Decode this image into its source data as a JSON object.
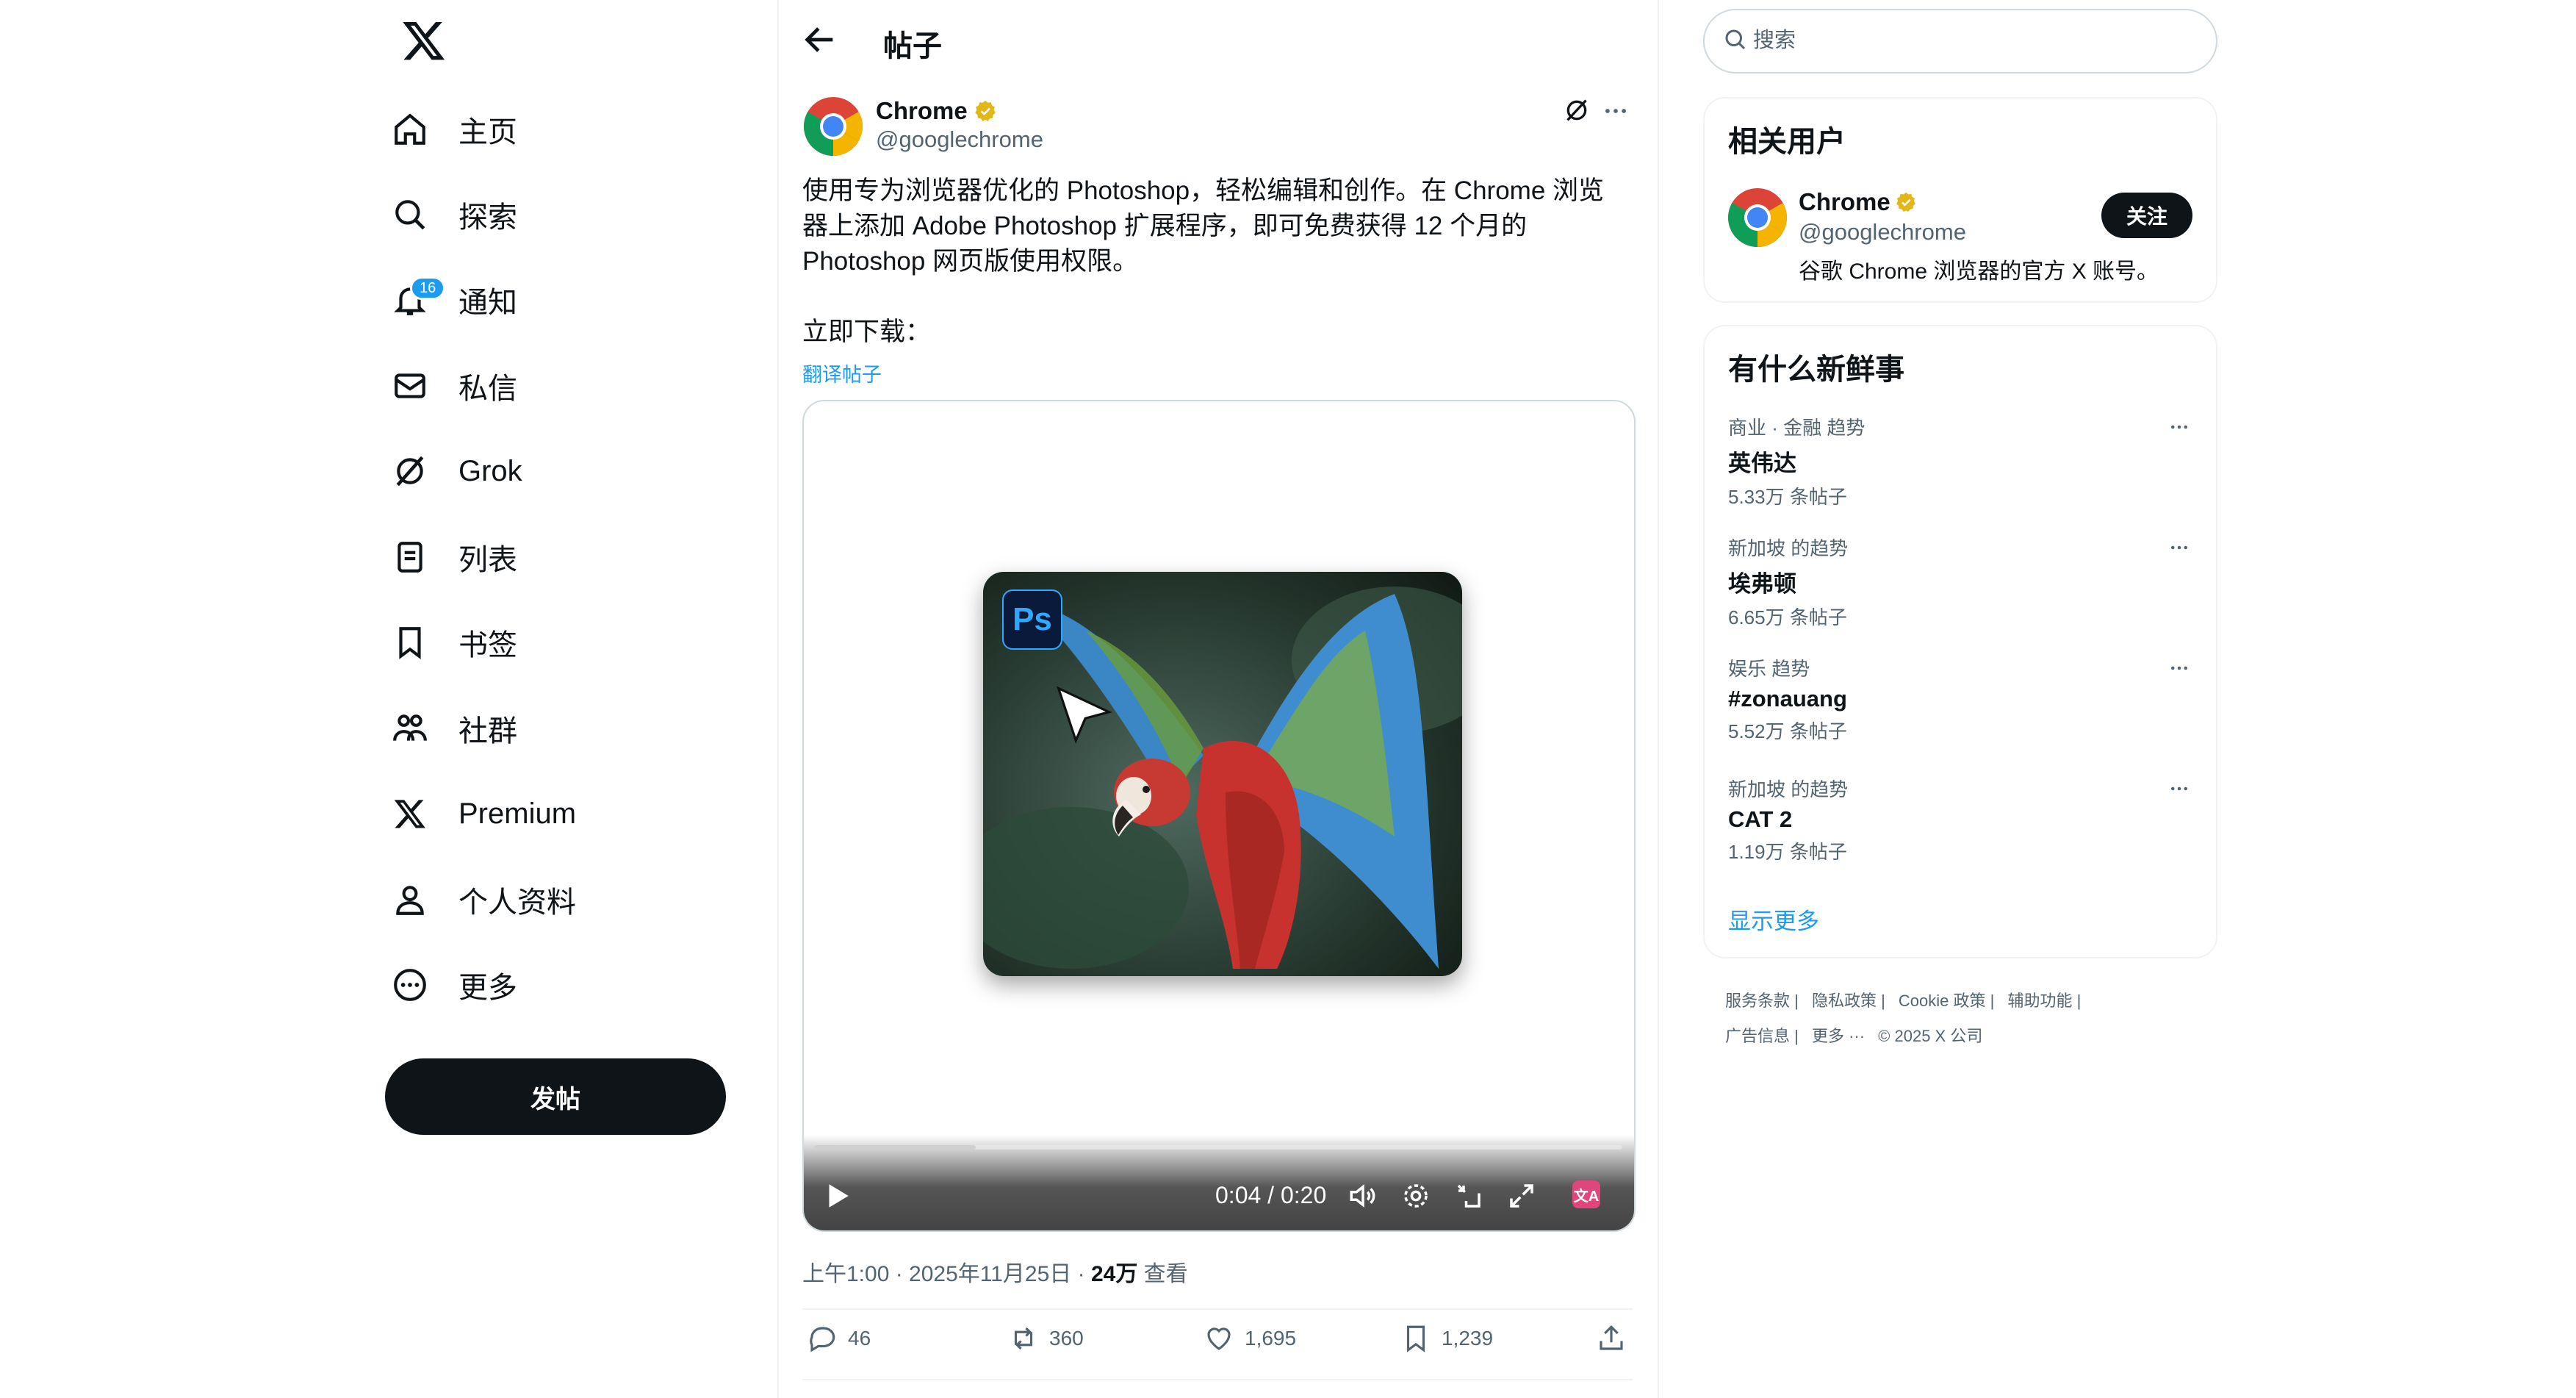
{
  "nav": {
    "items": [
      {
        "label": "主页",
        "icon": "home-icon"
      },
      {
        "label": "探索",
        "icon": "search-icon"
      },
      {
        "label": "通知",
        "icon": "bell-icon",
        "badge": "16"
      },
      {
        "label": "私信",
        "icon": "mail-icon"
      },
      {
        "label": "Grok",
        "icon": "grok-icon"
      },
      {
        "label": "列表",
        "icon": "list-icon"
      },
      {
        "label": "书签",
        "icon": "bookmark-icon"
      },
      {
        "label": "社群",
        "icon": "people-icon"
      },
      {
        "label": "Premium",
        "icon": "x-premium-icon"
      },
      {
        "label": "个人资料",
        "icon": "profile-icon"
      },
      {
        "label": "更多",
        "icon": "more-circle-icon"
      }
    ],
    "post_button": "发帖"
  },
  "header": {
    "title": "帖子"
  },
  "post": {
    "author_name": "Chrome",
    "author_handle": "@googlechrome",
    "text": "使用专为浏览器优化的 Photoshop，轻松编辑和创作。在 Chrome 浏览器上添加 Adobe Photoshop 扩展程序，即可免费获得 12 个月的 Photoshop 网页版使用权限。\n\n立即下载：",
    "translate_link": "翻译帖子",
    "video": {
      "badge_text": "Ps",
      "time": "0:04 / 0:20",
      "progress": 0.2
    },
    "timestamp": "上午1:00 · 2025年11月25日 · ",
    "views_count": "24万",
    "views_label": " 查看",
    "stats": {
      "replies": "46",
      "reposts": "360",
      "likes": "1,695",
      "bookmarks": "1,239"
    }
  },
  "search": {
    "placeholder": "搜索"
  },
  "related": {
    "title": "相关用户",
    "name": "Chrome",
    "handle": "@googlechrome",
    "bio": "谷歌 Chrome 浏览器的官方 X 账号。",
    "follow_label": "关注"
  },
  "trends": {
    "title": "有什么新鲜事",
    "items": [
      {
        "category": "商业 · 金融 趋势",
        "name": "英伟达",
        "count": "5.33万 条帖子"
      },
      {
        "category": "新加坡 的趋势",
        "name": "埃弗顿",
        "count": "6.65万 条帖子"
      },
      {
        "category": "娱乐 趋势",
        "name": "#zonauang",
        "count": "5.52万 条帖子"
      },
      {
        "category": "新加坡 的趋势",
        "name": "CAT 2",
        "count": "1.19万 条帖子"
      }
    ],
    "show_more": "显示更多"
  },
  "footer": {
    "links": [
      "服务条款 |",
      "隐私政策 |",
      "Cookie 政策 |",
      "辅助功能 |",
      "广告信息 |",
      "更多 ···",
      "© 2025 X 公司"
    ]
  },
  "colors": {
    "accent": "#1d9bf0",
    "verified": "#e2b719",
    "text": "#0f1419",
    "muted": "#536471"
  }
}
